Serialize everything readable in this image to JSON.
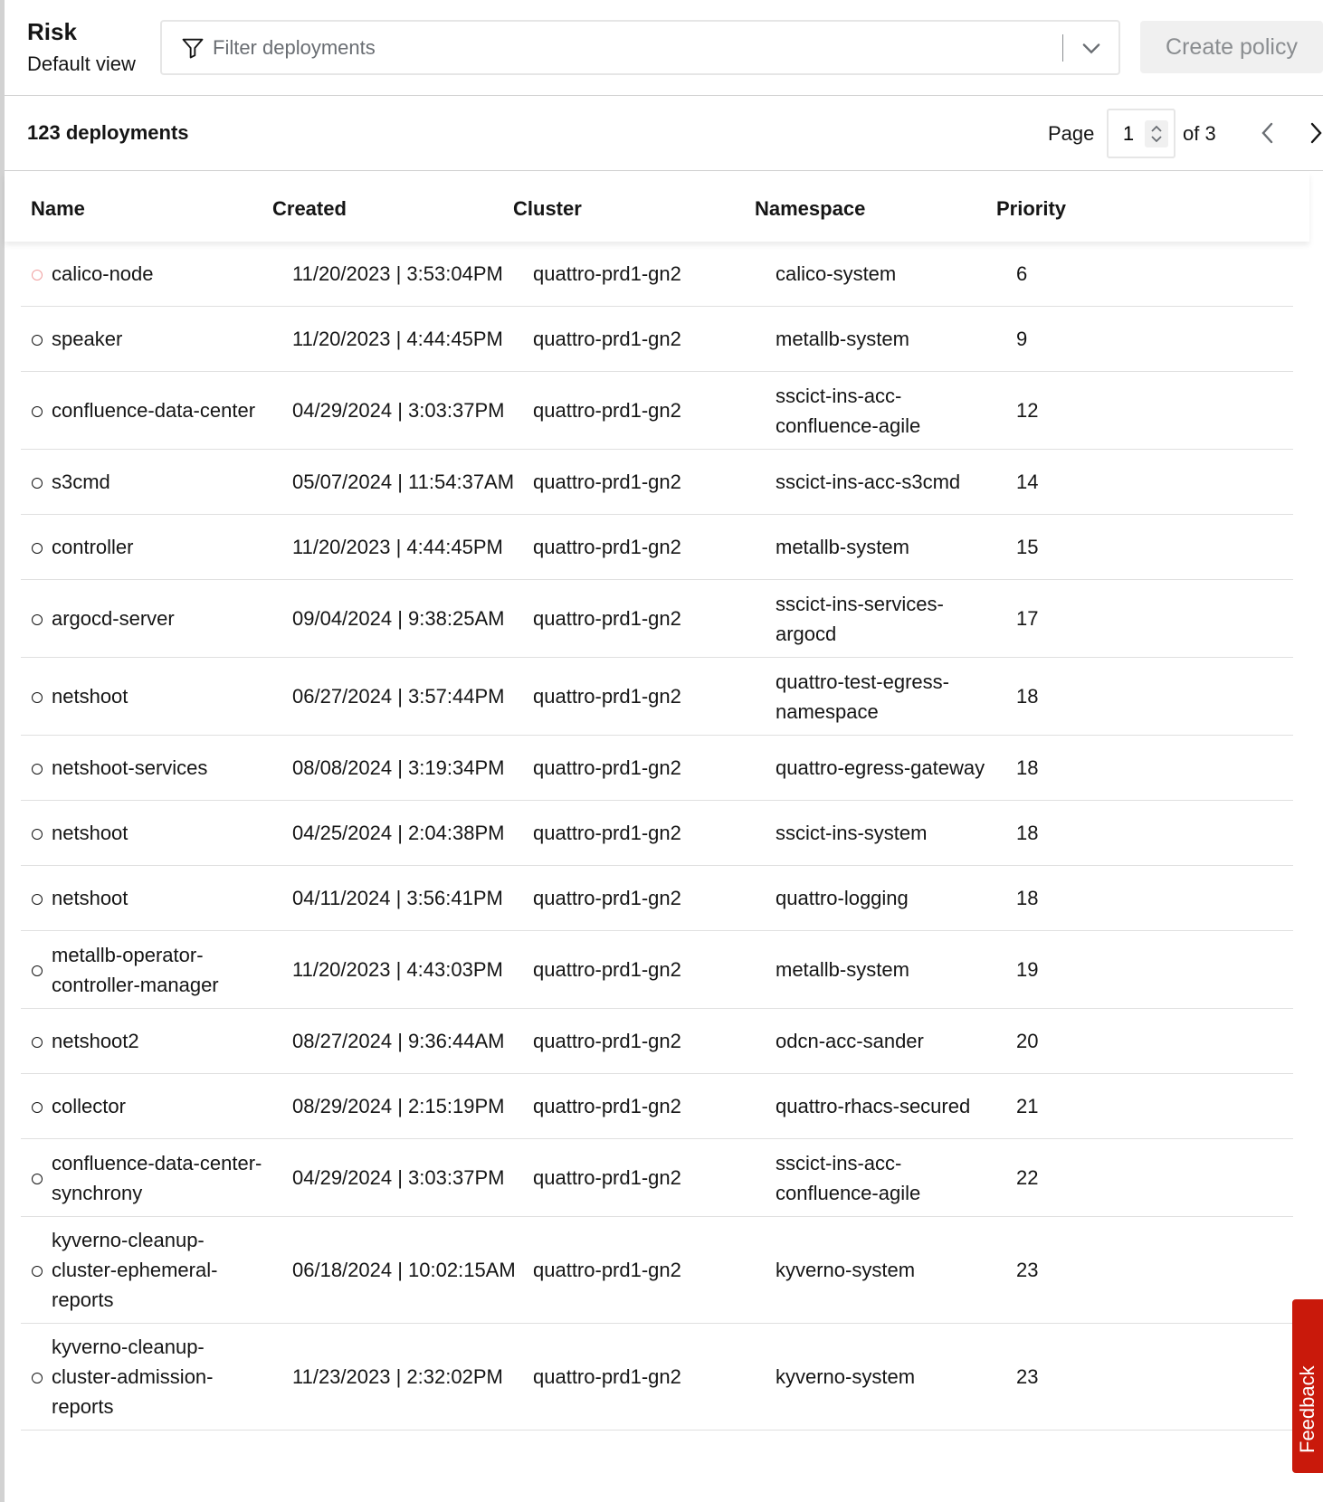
{
  "header": {
    "title": "Risk",
    "subtitle": "Default view",
    "filter_placeholder": "Filter deployments",
    "create_policy_label": "Create policy"
  },
  "toolbar": {
    "count_label": "123 deployments",
    "page_label": "Page",
    "page_value": "1",
    "page_of": "of 3"
  },
  "table": {
    "columns": [
      "Name",
      "Created",
      "Cluster",
      "Namespace",
      "Priority"
    ],
    "rows": [
      {
        "name": "calico-node",
        "created": "11/20/2023 | 3:53:04PM",
        "cluster": "quattro-prd1-gn2",
        "namespace": "calico-system",
        "priority": "6"
      },
      {
        "name": "speaker",
        "created": "11/20/2023 | 4:44:45PM",
        "cluster": "quattro-prd1-gn2",
        "namespace": "metallb-system",
        "priority": "9"
      },
      {
        "name": "confluence-data-center",
        "created": "04/29/2024 | 3:03:37PM",
        "cluster": "quattro-prd1-gn2",
        "namespace": "sscict-ins-acc-confluence-agile",
        "priority": "12"
      },
      {
        "name": "s3cmd",
        "created": "05/07/2024 | 11:54:37AM",
        "cluster": "quattro-prd1-gn2",
        "namespace": "sscict-ins-acc-s3cmd",
        "priority": "14"
      },
      {
        "name": "controller",
        "created": "11/20/2023 | 4:44:45PM",
        "cluster": "quattro-prd1-gn2",
        "namespace": "metallb-system",
        "priority": "15"
      },
      {
        "name": "argocd-server",
        "created": "09/04/2024 | 9:38:25AM",
        "cluster": "quattro-prd1-gn2",
        "namespace": "sscict-ins-services-argocd",
        "priority": "17"
      },
      {
        "name": "netshoot",
        "created": "06/27/2024 | 3:57:44PM",
        "cluster": "quattro-prd1-gn2",
        "namespace": "quattro-test-egress-namespace",
        "priority": "18"
      },
      {
        "name": "netshoot-services",
        "created": "08/08/2024 | 3:19:34PM",
        "cluster": "quattro-prd1-gn2",
        "namespace": "quattro-egress-gateway",
        "priority": "18"
      },
      {
        "name": "netshoot",
        "created": "04/25/2024 | 2:04:38PM",
        "cluster": "quattro-prd1-gn2",
        "namespace": "sscict-ins-system",
        "priority": "18"
      },
      {
        "name": "netshoot",
        "created": "04/11/2024 | 3:56:41PM",
        "cluster": "quattro-prd1-gn2",
        "namespace": "quattro-logging",
        "priority": "18"
      },
      {
        "name": "metallb-operator-controller-manager",
        "created": "11/20/2023 | 4:43:03PM",
        "cluster": "quattro-prd1-gn2",
        "namespace": "metallb-system",
        "priority": "19"
      },
      {
        "name": "netshoot2",
        "created": "08/27/2024 | 9:36:44AM",
        "cluster": "quattro-prd1-gn2",
        "namespace": "odcn-acc-sander",
        "priority": "20"
      },
      {
        "name": "collector",
        "created": "08/29/2024 | 2:15:19PM",
        "cluster": "quattro-prd1-gn2",
        "namespace": "quattro-rhacs-secured",
        "priority": "21"
      },
      {
        "name": "confluence-data-center-synchrony",
        "created": "04/29/2024 | 3:03:37PM",
        "cluster": "quattro-prd1-gn2",
        "namespace": "sscict-ins-acc-confluence-agile",
        "priority": "22"
      },
      {
        "name": "kyverno-cleanup-cluster-ephemeral-reports",
        "created": "06/18/2024 | 10:02:15AM",
        "cluster": "quattro-prd1-gn2",
        "namespace": "kyverno-system",
        "priority": "23"
      },
      {
        "name": "kyverno-cleanup-cluster-admission-reports",
        "created": "11/23/2023 | 2:32:02PM",
        "cluster": "quattro-prd1-gn2",
        "namespace": "kyverno-system",
        "priority": "23"
      }
    ]
  },
  "feedback": {
    "label": "Feedback"
  },
  "colors": {
    "accent_red": "#c9190b",
    "alert_ring": "#f0a0a0",
    "disabled_bg": "#f0f0f0"
  }
}
